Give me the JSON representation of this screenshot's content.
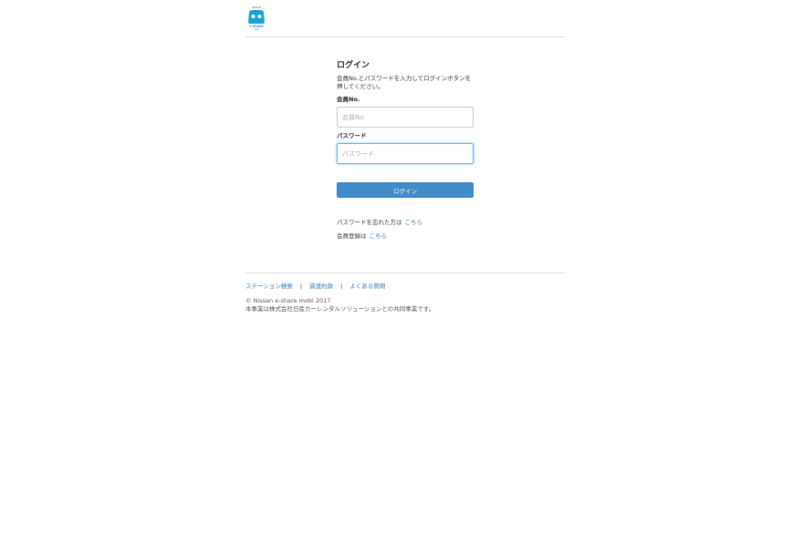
{
  "header": {
    "logo_top_text": "NISSAN",
    "logo_text": "e-SHARE",
    "logo_sub_text": "mobi"
  },
  "login": {
    "title": "ログイン",
    "description": "会員No.とパスワードを入力してログインボタンを押してください。",
    "member_label": "会員No.",
    "member_placeholder": "会員No.",
    "member_value": "",
    "password_label": "パスワード",
    "password_placeholder": "パスワード",
    "password_value": "",
    "button_label": "ログイン"
  },
  "links": {
    "forgot_text": "パスワードを忘れた方は",
    "forgot_link": "こちら",
    "register_text": "会員登録は",
    "register_link": "こちら"
  },
  "footer": {
    "nav": [
      "ステーション検索",
      "貸渡約款",
      "よくある質問"
    ],
    "separator": "|",
    "copyright": "© Nissan e-share mobi 2017",
    "note": "本事業は株式会社日産カーレンタルソリューションとの共同事業です。"
  },
  "colors": {
    "accent": "#428bca",
    "link": "#337ab7",
    "logo": "#1aa3d9"
  }
}
